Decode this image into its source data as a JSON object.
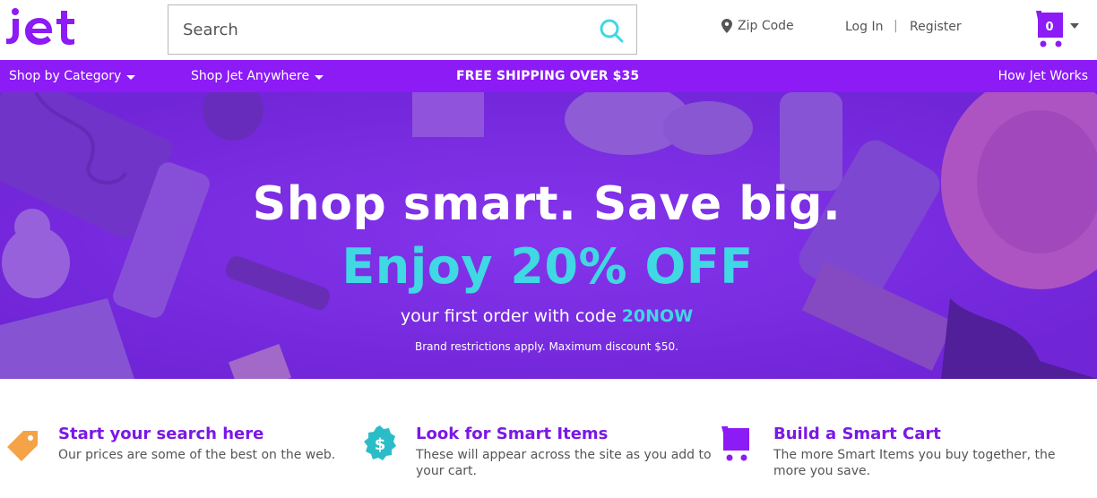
{
  "brand": {
    "logo_text": "jet"
  },
  "search": {
    "placeholder": "Search",
    "value": ""
  },
  "header": {
    "zip_label": "Zip Code",
    "login_label": "Log In",
    "separator": "|",
    "register_label": "Register",
    "cart_count": "0"
  },
  "nav": {
    "shop_by_category": "Shop by Category",
    "shop_anywhere": "Shop Jet Anywhere",
    "free_shipping": "FREE SHIPPING OVER $35",
    "how_it_works": "How Jet Works"
  },
  "hero": {
    "title": "Shop smart. Save big.",
    "offer": "Enjoy 20% OFF",
    "code_prefix": "your first order with code",
    "code": "20NOW",
    "fine_print": "Brand restrictions apply. Maximum discount $50."
  },
  "features": [
    {
      "title": "Start your search here",
      "text": "Our prices are some of the best on the web.",
      "icon": "price-tag-icon"
    },
    {
      "title": "Look for Smart Items",
      "text": "These will appear across the site as you add to your cart.",
      "icon": "dollar-badge-icon"
    },
    {
      "title": "Build a Smart Cart",
      "text": "The more Smart Items you buy together, the more you save.",
      "icon": "cart-icon"
    }
  ],
  "colors": {
    "brand_purple": "#8c1bf6",
    "hero_purple": "#7b2ae4",
    "accent_cyan": "#3fd8e3",
    "tag_orange": "#f5a347",
    "badge_teal": "#2bbdc7"
  }
}
